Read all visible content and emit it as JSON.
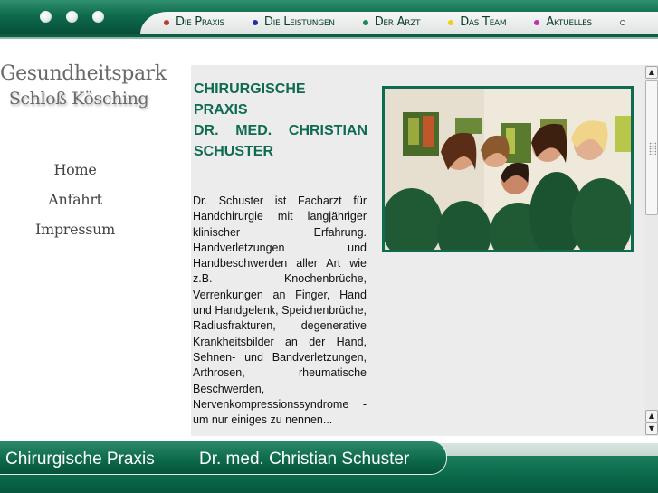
{
  "nav": {
    "items": [
      {
        "label": "Die Praxis",
        "bullet_color": "#c0392b"
      },
      {
        "label": "Die Leistungen",
        "bullet_color": "#1f2fa8"
      },
      {
        "label": "Der Arzt",
        "bullet_color": "#1b8a5a"
      },
      {
        "label": "Das Team",
        "bullet_color": "#e8d21a"
      },
      {
        "label": "Aktuelles",
        "bullet_color": "#c02fb0"
      },
      {
        "label": "",
        "bullet_color": "#ffffff"
      }
    ]
  },
  "logo": {
    "line1": "Gesundheitspark",
    "line2": "Schloß Kösching"
  },
  "sidebar": {
    "items": [
      {
        "label": "Home"
      },
      {
        "label": "Anfahrt"
      },
      {
        "label": "Impressum"
      }
    ]
  },
  "main": {
    "heading": [
      "CHIRURGISCHE",
      "PRAXIS",
      "DR. MED. CHRISTIAN",
      "SCHUSTER"
    ],
    "body": "Dr. Schuster ist Facharzt für Handchirurgie mit langjähriger klinischer Erfahrung. Handverletzungen und Handbeschwerden aller Art wie z.B. Knochenbrüche, Verrenkungen an Finger, Hand und Handgelenk, Speichenbrüche, Radiusfrakturen, degenerative Krankheitsbilder an der Hand, Sehnen- und Bandverletzungen, Arthrosen, rheumatische Beschwerden, Nervenkompressionssyndrome - um nur einiges zu nennen..."
  },
  "footer": {
    "left": "Chirurgische Praxis",
    "right": "Dr. med. Christian Schuster"
  },
  "colors": {
    "brand_green": "#0e6b52",
    "topbar_green": "#0f6a4d"
  }
}
